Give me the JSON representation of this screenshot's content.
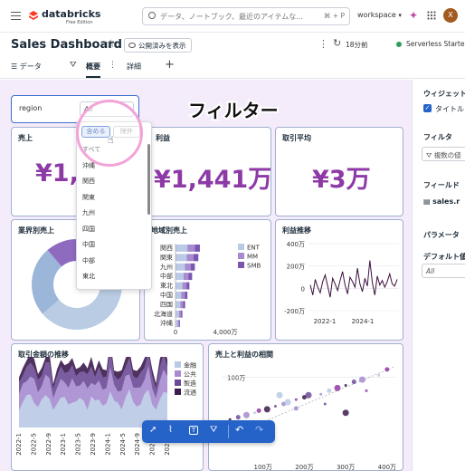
{
  "topbar": {
    "app_name": "databricks",
    "edition": "Free Edition",
    "search_placeholder": "データ、ノートブック、最近のアイテムな...",
    "search_shortcut": "⌘ + P",
    "workspace": "workspace",
    "avatar_letter": "X"
  },
  "header": {
    "title": "Sales Dashboard",
    "publish_label": "公開済みを表示",
    "refresh_time": "18分前",
    "compute": "Serverless Starter",
    "tabs": [
      {
        "label": "データ"
      },
      {
        "label": "概要"
      },
      {
        "label": "詳細"
      }
    ],
    "active_tab": "概要"
  },
  "filter_widget": {
    "field": "region",
    "value": "All",
    "include_label": "含める",
    "exclude_label": "除外",
    "options": [
      "すべて",
      "沖縄",
      "関西",
      "関東",
      "九州",
      "四国",
      "中国",
      "中部",
      "東北"
    ]
  },
  "annotation": "フィルター",
  "kpis": [
    {
      "title": "売上",
      "value": "¥1,0"
    },
    {
      "title": "利益",
      "value": "¥1,441万"
    },
    {
      "title": "取引平均",
      "value": "¥3万"
    }
  ],
  "right_panel": {
    "widget_title": "ウィジェット",
    "title_checkbox_label": "タイトル",
    "filter_title": "フィルタ",
    "filter_value": "複数の値",
    "field_title": "フィールド",
    "field_value": "sales.r",
    "param_title": "パラメータ",
    "default_title": "デフォルト値",
    "default_value": "All"
  },
  "toolbar": {
    "icons": [
      "select-icon",
      "chart-icon",
      "text-icon",
      "filter-icon",
      "undo-icon",
      "redo-icon"
    ]
  },
  "colors": {
    "accent": "#8e3aa6",
    "canvas": "#f4ecfa",
    "toolbar": "#2563c9",
    "ent": "#b9c9e6",
    "mm": "#a68bcf",
    "smb": "#7a55b1"
  },
  "chart_data": [
    {
      "type": "pie",
      "title": "業界別売上",
      "values": [
        55,
        25,
        12,
        8
      ],
      "colors": [
        "#b9cce4",
        "#9bb6d8",
        "#8e6bbf",
        "#6b4ea6"
      ]
    },
    {
      "type": "bar",
      "title": "地域別売上",
      "categories": [
        "関西",
        "関東",
        "九州",
        "中部",
        "東北",
        "中国",
        "四国",
        "北海道",
        "沖縄"
      ],
      "series": [
        {
          "name": "ENT",
          "values": [
            950,
            900,
            750,
            650,
            550,
            450,
            380,
            280,
            180
          ]
        },
        {
          "name": "MM",
          "values": [
            600,
            550,
            480,
            400,
            330,
            300,
            230,
            160,
            100
          ]
        },
        {
          "name": "SMB",
          "values": [
            400,
            380,
            320,
            280,
            230,
            200,
            160,
            110,
            70
          ]
        }
      ],
      "xticks": [
        "0",
        "4,000万"
      ],
      "xlim": [
        0,
        4200
      ]
    },
    {
      "type": "line",
      "title": "利益推移",
      "yticks": [
        "400万",
        "200万",
        "0",
        "-200万"
      ],
      "xticks": [
        "2022-1",
        "2024-1"
      ],
      "ylim": [
        -200,
        400
      ],
      "values": [
        30,
        -60,
        80,
        10,
        -40,
        60,
        120,
        20,
        -80,
        90,
        40,
        -20,
        70,
        150,
        30,
        -50,
        100,
        60,
        10,
        180,
        40,
        -30,
        90,
        20,
        250,
        50,
        -60,
        110,
        30,
        70,
        10,
        60,
        130,
        40,
        20,
        80
      ]
    },
    {
      "type": "area",
      "title": "取引金額の推移",
      "legend": [
        "金融",
        "公共",
        "製造",
        "流通"
      ],
      "xticks": [
        "2022-1",
        "2022-5",
        "2022-9",
        "2023-1",
        "2023-5",
        "2023-9",
        "2024-1",
        "2024-5",
        "2024-9",
        "2025-1",
        "2025-5"
      ]
    },
    {
      "type": "scatter",
      "title": "売上と利益の相関",
      "yticks": [
        "100万"
      ],
      "xticks": [
        "100万",
        "200万",
        "300万",
        "400万"
      ],
      "xlim": [
        0,
        420
      ],
      "ylim": [
        -50,
        130
      ],
      "points": [
        [
          20,
          5
        ],
        [
          40,
          10
        ],
        [
          60,
          15
        ],
        [
          80,
          20
        ],
        [
          90,
          25
        ],
        [
          110,
          28
        ],
        [
          130,
          35
        ],
        [
          150,
          40
        ],
        [
          160,
          44
        ],
        [
          180,
          50
        ],
        [
          200,
          55
        ],
        [
          210,
          60
        ],
        [
          240,
          62
        ],
        [
          260,
          70
        ],
        [
          280,
          76
        ],
        [
          300,
          82
        ],
        [
          320,
          90
        ],
        [
          340,
          95
        ],
        [
          380,
          105
        ],
        [
          400,
          118
        ],
        [
          300,
          20
        ],
        [
          250,
          40
        ],
        [
          180,
          30
        ],
        [
          140,
          60
        ],
        [
          350,
          70
        ]
      ]
    }
  ]
}
